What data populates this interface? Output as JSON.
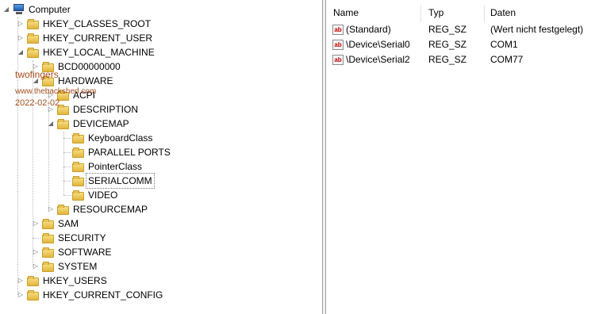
{
  "tree": {
    "root": "Computer",
    "hives": {
      "classes_root": "HKEY_CLASSES_ROOT",
      "current_user": "HKEY_CURRENT_USER",
      "local_machine": "HKEY_LOCAL_MACHINE",
      "users": "HKEY_USERS",
      "current_config": "HKEY_CURRENT_CONFIG"
    },
    "hklm": {
      "bcd": "BCD00000000",
      "hardware": "HARDWARE",
      "sam": "SAM",
      "security": "SECURITY",
      "software": "SOFTWARE",
      "system": "SYSTEM"
    },
    "hardware": {
      "acpi": "ACPI",
      "description": "DESCRIPTION",
      "devicemap": "DEVICEMAP",
      "resourcemap": "RESOURCEMAP"
    },
    "devicemap": {
      "keyboard": "KeyboardClass",
      "parallel": "PARALLEL PORTS",
      "pointer": "PointerClass",
      "serialcomm": "SERIALCOMM",
      "video": "VIDEO"
    }
  },
  "watermark": {
    "user": "twofingers",
    "site": "www.thebackshed.com",
    "date": "2022-02-02"
  },
  "list": {
    "columns": {
      "name": "Name",
      "type": "Typ",
      "data": "Daten"
    },
    "rows": [
      {
        "icon": "ab",
        "name": "(Standard)",
        "type": "REG_SZ",
        "data": "(Wert nicht festgelegt)"
      },
      {
        "icon": "ab",
        "name": "\\Device\\Serial0",
        "type": "REG_SZ",
        "data": "COM1"
      },
      {
        "icon": "ab",
        "name": "\\Device\\Serial2",
        "type": "REG_SZ",
        "data": "COM77"
      }
    ]
  }
}
